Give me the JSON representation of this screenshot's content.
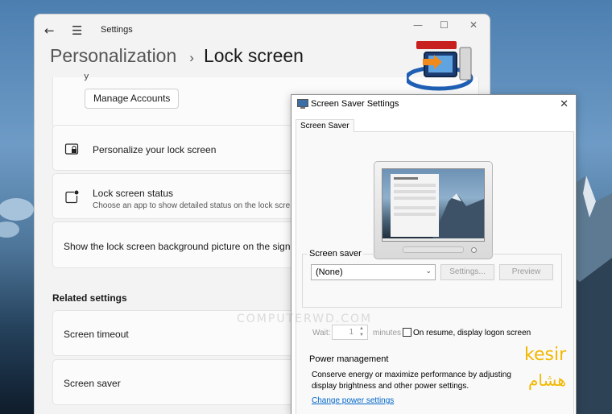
{
  "settings": {
    "app_title": "Settings",
    "breadcrumb": {
      "parent": "Personalization",
      "separator": "›",
      "current": "Lock screen"
    },
    "accounts_partial_text": "y",
    "manage_accounts_label": "Manage Accounts",
    "personalize_label": "Personalize your lock screen",
    "status_label": "Lock screen status",
    "status_sub": "Choose an app to show detailed status on the lock scre",
    "signin_label": "Show the lock screen background picture on the sign-i",
    "related_title": "Related settings",
    "timeout_label": "Screen timeout",
    "saver_label": "Screen saver"
  },
  "dialog": {
    "title": "Screen Saver Settings",
    "tab": "Screen Saver",
    "group_saver_title": "Screen saver",
    "selected": "(None)",
    "settings_btn": "Settings...",
    "preview_btn": "Preview",
    "wait_label": "Wait:",
    "wait_value": "1",
    "minutes_label": "minutes",
    "resume_label": "On resume, display logon screen",
    "resume_checked": false,
    "power_title": "Power management",
    "power_desc": "Conserve energy or maximize performance by adjusting display brightness and other power settings.",
    "power_link": "Change power settings"
  },
  "overlay": {
    "watermark": "COMPUTERWD.COM",
    "signature_latin": "kesir",
    "signature_arabic": "هشام"
  },
  "icons": {
    "back": "back-arrow-icon",
    "menu": "hamburger-menu-icon",
    "lock": "lock-screen-icon",
    "status": "lock-status-icon",
    "monitor": "monitor-icon"
  },
  "colors": {
    "link": "#0066cc",
    "signature": "#f2b800",
    "accent": "#0067c0"
  }
}
